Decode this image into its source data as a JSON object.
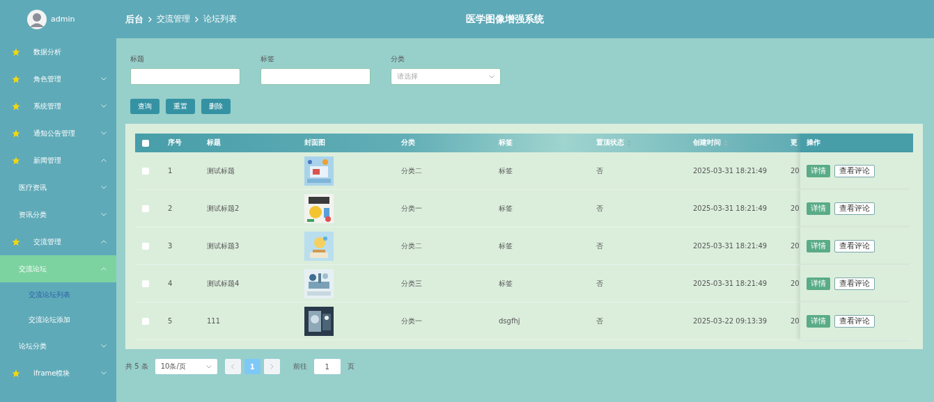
{
  "user": {
    "name": "admin"
  },
  "breadcrumb": [
    "后台",
    "交流管理",
    "论坛列表"
  ],
  "app_title": "医学图像增强系统",
  "sidebar": {
    "items": [
      {
        "label": "数据分析",
        "selected": false
      },
      {
        "label": "角色管理",
        "selected": false,
        "expanded": false
      },
      {
        "label": "系统管理",
        "selected": false,
        "expanded": false
      },
      {
        "label": "通知公告管理",
        "selected": false,
        "expanded": false
      },
      {
        "label": "新闻管理",
        "selected": false,
        "expanded": true,
        "children": [
          {
            "label": "医疗资讯",
            "selected": false,
            "expanded": false
          },
          {
            "label": "资讯分类",
            "selected": false,
            "expanded": false
          }
        ]
      },
      {
        "label": "交流管理",
        "selected": false,
        "expanded": true,
        "children": [
          {
            "label": "交流论坛",
            "selected": true,
            "expanded": true,
            "children": [
              {
                "label": "交流论坛列表",
                "selected": true
              },
              {
                "label": "交流论坛添加",
                "selected": false
              }
            ]
          },
          {
            "label": "论坛分类",
            "selected": false,
            "expanded": false
          }
        ]
      },
      {
        "label": "iframe模块",
        "selected": false,
        "expanded": false
      }
    ]
  },
  "filters": [
    {
      "label": "标题",
      "kind": "text"
    },
    {
      "label": "标签",
      "kind": "text"
    },
    {
      "label": "分类",
      "kind": "select",
      "placeholder": "请选择"
    }
  ],
  "buttons": [
    "查询",
    "重置",
    "删除"
  ],
  "table": {
    "select_all": {
      "checked": false
    },
    "columns": [
      {
        "label": "序号"
      },
      {
        "label": "标题"
      },
      {
        "label": "封面图"
      },
      {
        "label": "分类"
      },
      {
        "label": "标签"
      },
      {
        "label": "置顶状态",
        "sortable": true
      },
      {
        "label": "创建时间",
        "sortable": true
      },
      {
        "label": "更"
      },
      {
        "label": "操作"
      }
    ],
    "rows": [
      {
        "checked": false,
        "cells": [
          "1",
          "测试标题",
          null,
          "分类二",
          "标签",
          "否",
          "2025-03-31 18:21:49",
          "20"
        ],
        "cover": {
          "kind": "picture"
        },
        "actions": [
          {
            "label": "详情",
            "kind": "primary"
          },
          {
            "label": "查看评论",
            "kind": "plain"
          }
        ]
      },
      {
        "checked": false,
        "cells": [
          "2",
          "测试标题2",
          null,
          "分类一",
          "标签",
          "否",
          "2025-03-31 18:21:49",
          "20"
        ],
        "cover": {
          "kind": "picture"
        },
        "actions": [
          {
            "label": "详情",
            "kind": "primary"
          },
          {
            "label": "查看评论",
            "kind": "plain"
          }
        ]
      },
      {
        "checked": false,
        "cells": [
          "3",
          "测试标题3",
          null,
          "分类二",
          "标签",
          "否",
          "2025-03-31 18:21:49",
          "20"
        ],
        "cover": {
          "kind": "picture"
        },
        "actions": [
          {
            "label": "详情",
            "kind": "primary"
          },
          {
            "label": "查看评论",
            "kind": "plain"
          }
        ]
      },
      {
        "checked": false,
        "cells": [
          "4",
          "测试标题4",
          null,
          "分类三",
          "标签",
          "否",
          "2025-03-31 18:21:49",
          "20"
        ],
        "cover": {
          "kind": "picture"
        },
        "actions": [
          {
            "label": "详情",
            "kind": "primary"
          },
          {
            "label": "查看评论",
            "kind": "plain"
          }
        ]
      },
      {
        "checked": false,
        "cells": [
          "5",
          "111",
          null,
          "分类一",
          "dsgfhj",
          "否",
          "2025-03-22 09:13:39",
          "20"
        ],
        "cover": {
          "kind": "picture"
        },
        "actions": [
          {
            "label": "详情",
            "kind": "primary"
          },
          {
            "label": "查看评论",
            "kind": "plain"
          }
        ]
      }
    ]
  },
  "pagination": {
    "total": "共 5 条",
    "page_size": "10条/页",
    "pages": [
      {
        "label": "1",
        "selected": true
      }
    ],
    "goto_label": "前往",
    "goto_value": "1",
    "goto_suffix": "页"
  }
}
